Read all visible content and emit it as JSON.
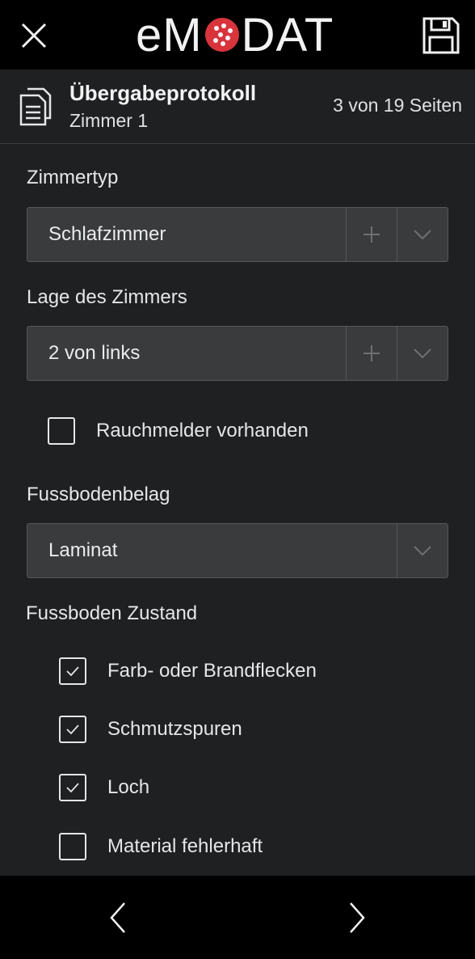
{
  "app": {
    "logo_left": "eM",
    "logo_right": "DAT",
    "close_icon": "close-icon",
    "save_icon": "floppy-disk-icon"
  },
  "header": {
    "title": "Übergabeprotokoll",
    "subtitle": "Zimmer 1",
    "page_count": "3 von 19 Seiten"
  },
  "form": {
    "room_type": {
      "label": "Zimmertyp",
      "value": "Schlafzimmer"
    },
    "room_position": {
      "label": "Lage des Zimmers",
      "value": "2 von links"
    },
    "smoke_detector": {
      "label": "Rauchmelder vorhanden",
      "checked": false
    },
    "floor_covering": {
      "label": "Fussbodenbelag",
      "value": "Laminat"
    },
    "floor_condition": {
      "label": "Fussboden Zustand",
      "options": [
        {
          "label": "Farb- oder Brandflecken",
          "checked": true
        },
        {
          "label": "Schmutzspuren",
          "checked": true
        },
        {
          "label": "Loch",
          "checked": true
        },
        {
          "label": "Material fehlerhaft",
          "checked": false
        }
      ]
    }
  },
  "colors": {
    "background": "#1e2022",
    "bar": "#000000",
    "field": "#3a3b3d",
    "logo_accent": "#d8343c"
  }
}
